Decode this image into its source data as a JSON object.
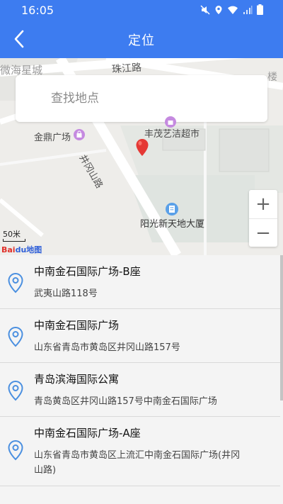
{
  "status_bar": {
    "time": "16:05"
  },
  "app_bar": {
    "title": "定位"
  },
  "map": {
    "search_placeholder": "查找地点",
    "labels": {
      "haixing": "微海星城",
      "zhujiang": "珠江路",
      "lou": "楼",
      "jinding": "金鼎广场",
      "fengmao": "丰茂艺洁超市",
      "jinggang": "井冈山路",
      "yangguang": "阳光新天地大厦"
    },
    "scale_label": "50米",
    "logo_text_red": "Bai",
    "logo_text_blue": "du地图",
    "zoom_in": "+",
    "zoom_out": "−"
  },
  "results": [
    {
      "name": "中南金石国际广场-B座",
      "address": "武夷山路118号"
    },
    {
      "name": "中南金石国际广场",
      "address": "山东省青岛市黄岛区井冈山路157号"
    },
    {
      "name": "青岛滨海国际公寓",
      "address": "青岛黄岛区井冈山路157号中南金石国际广场"
    },
    {
      "name": "中南金石国际广场-A座",
      "address": "山东省青岛市黄岛区上流汇中南金石国际广场(井冈山路)"
    }
  ],
  "colors": {
    "primary": "#3d7cf0",
    "pin": "#e53935",
    "location_icon": "#4a8fe0"
  }
}
